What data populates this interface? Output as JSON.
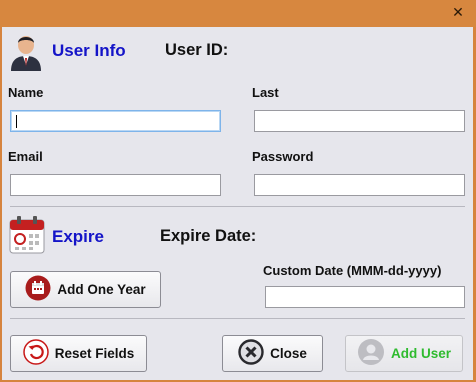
{
  "window": {
    "close_glyph": "✕"
  },
  "user_info": {
    "title": "User Info",
    "user_id_label": "User ID:",
    "icon": "user-avatar-icon"
  },
  "fields": {
    "name_label": "Name",
    "name_value": "",
    "last_label": "Last",
    "last_value": "",
    "email_label": "Email",
    "email_value": "",
    "password_label": "Password",
    "password_value": ""
  },
  "expire": {
    "title": "Expire",
    "expire_date_label": "Expire Date:",
    "custom_date_label": "Custom Date (MMM-dd-yyyy)",
    "custom_date_value": "",
    "add_one_year_label": "Add One Year",
    "icon": "calendar-icon"
  },
  "buttons": {
    "reset_label": "Reset Fields",
    "close_label": "Close",
    "add_user_label": "Add User"
  },
  "colors": {
    "title_bar": "#d7873f",
    "panel": "#e6e6ec",
    "section_title": "#1414c8",
    "add_user_text": "#2fbb2f"
  }
}
